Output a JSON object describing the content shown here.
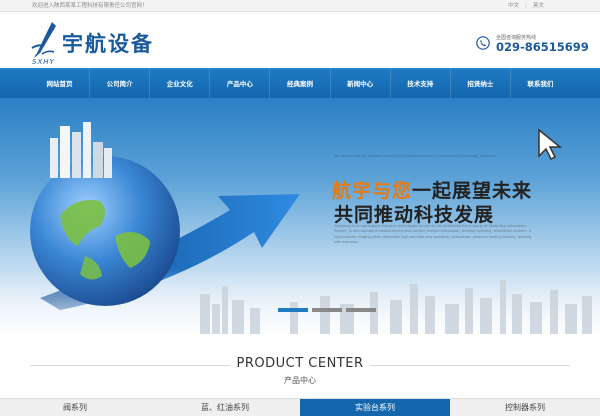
{
  "topbar": {
    "welcome": "欢迎进入陕西某某工程科技有限责任公司官网！",
    "lang_cn": "中文",
    "lang_en": "英文"
  },
  "header": {
    "logo_name": "宇航设备",
    "logo_abbr": "SXHY",
    "hotline_label": "全国咨询服务热线",
    "hotline_number": "029-86515699"
  },
  "nav": {
    "items": [
      "网站首页",
      "公司简介",
      "企业文化",
      "产品中心",
      "经典案例",
      "新闻中心",
      "技术支持",
      "招贤纳士",
      "联系我们"
    ]
  },
  "banner": {
    "tagline": "We will be looking forward to the future development of science and technology, together",
    "headline1_accent": "航宇与您",
    "headline1_rest": "一起展望未来",
    "headline2": "共同推动科技发展",
    "body_text": "Company is an aerospace industry technology to rely on, to undertake the a group of State Key Laboratory Project, in non-standard measurement and control, motion simulation, braking systems, simulation system, a synchronizer forging when detection high and low new powders, hydrostatic pressure testing factory, braking test machine."
  },
  "product_center": {
    "title_en": "PRODUCT CENTER",
    "title_cn": "产品中心",
    "tabs": [
      {
        "label": "阀系列",
        "active": false
      },
      {
        "label": "蓝、红油系列",
        "active": false
      },
      {
        "label": "实验台系列",
        "active": true
      },
      {
        "label": "控制器系列",
        "active": false
      }
    ]
  },
  "colors": {
    "brand_blue": "#1467ad",
    "accent_orange": "#e57b14"
  },
  "icons": {
    "logo": "rocket-logo-icon",
    "phone": "phone-icon",
    "cursor": "mouse-cursor-icon"
  }
}
